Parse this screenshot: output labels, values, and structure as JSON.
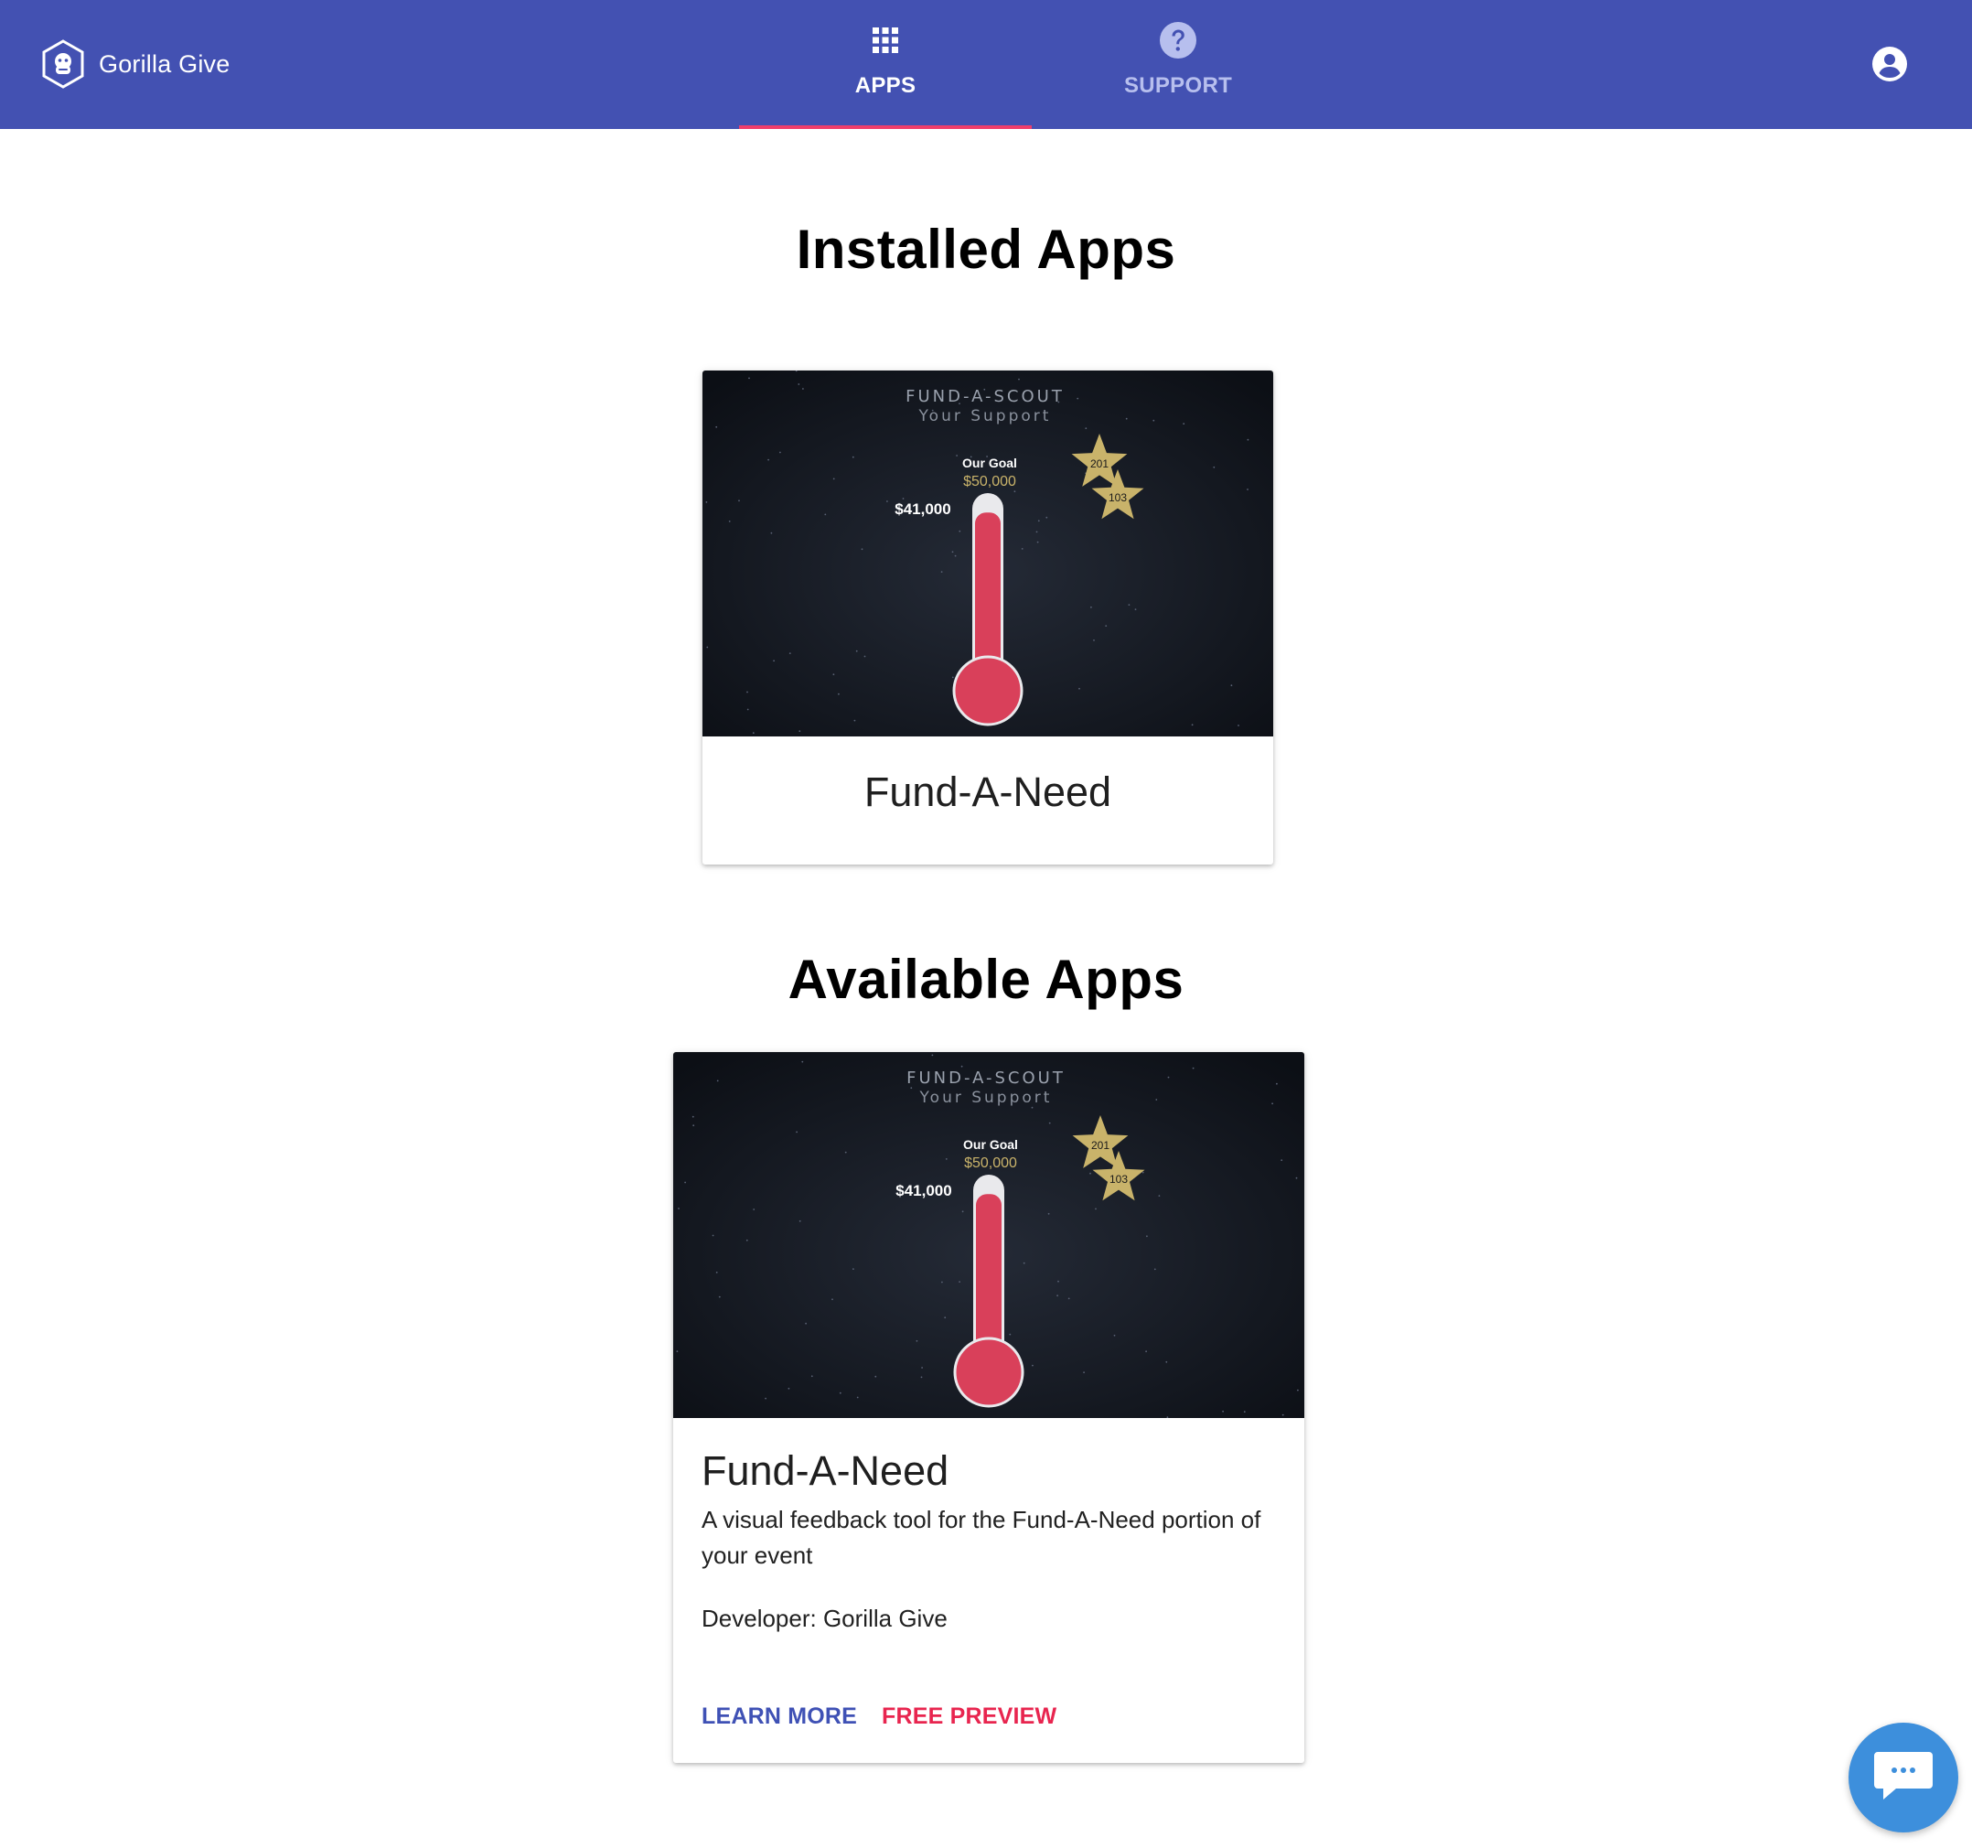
{
  "header": {
    "brand_name": "Gorilla Give",
    "tabs": [
      {
        "label": "APPS",
        "icon": "apps-grid-icon",
        "active": true
      },
      {
        "label": "SUPPORT",
        "icon": "help-circle-icon",
        "active": false
      }
    ],
    "account_icon": "account-circle-icon"
  },
  "colors": {
    "header_bg": "#4351b2",
    "tab_indicator": "#ef3e6b",
    "primary_action": "#3f51b5",
    "secondary_action": "#e8254f",
    "chat_fab": "#3d8fdc",
    "thermometer_fill": "#d9405a",
    "star": "#c9b36a"
  },
  "installed_section": {
    "title": "Installed Apps",
    "apps": [
      {
        "name": "Fund-A-Need",
        "preview": {
          "heading": "FUND-A-SCOUT",
          "subheading": "Your Support",
          "goal_label": "Our Goal",
          "goal_amount": "$50,000",
          "raised_amount": "$41,000",
          "raised_fraction": 0.82,
          "stars": [
            "201",
            "103"
          ]
        }
      }
    ]
  },
  "available_section": {
    "title": "Available Apps",
    "apps": [
      {
        "name": "Fund-A-Need",
        "description": "A visual feedback tool for the Fund-A-Need portion of your event",
        "developer": "Developer: Gorilla Give",
        "learn_more_label": "LEARN MORE",
        "preview_label": "FREE PREVIEW",
        "preview": {
          "heading": "FUND-A-SCOUT",
          "subheading": "Your Support",
          "goal_label": "Our Goal",
          "goal_amount": "$50,000",
          "raised_amount": "$41,000",
          "raised_fraction": 0.82,
          "stars": [
            "201",
            "103"
          ]
        }
      }
    ]
  },
  "chat": {
    "icon": "chat-bubble-icon"
  }
}
